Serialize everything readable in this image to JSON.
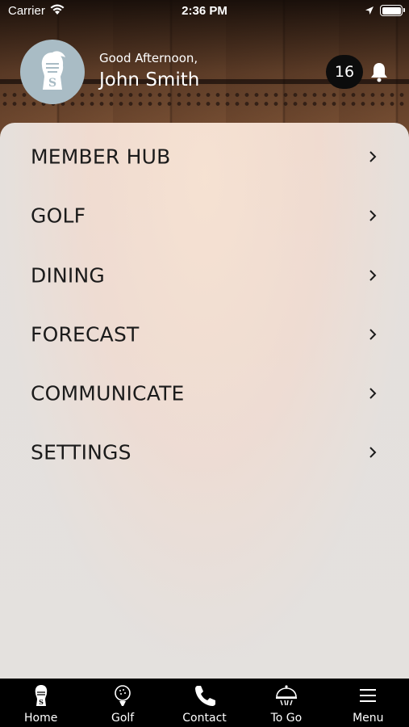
{
  "status_bar": {
    "carrier": "Carrier",
    "time": "2:36 PM"
  },
  "profile": {
    "greeting": "Good Afternoon,",
    "name": "John Smith",
    "notification_count": "16"
  },
  "menu": {
    "items": [
      {
        "label": "MEMBER HUB"
      },
      {
        "label": "GOLF"
      },
      {
        "label": "DINING"
      },
      {
        "label": "FORECAST"
      },
      {
        "label": "COMMUNICATE"
      },
      {
        "label": "SETTINGS"
      }
    ]
  },
  "tab_bar": {
    "tabs": [
      {
        "label": "Home",
        "icon": "knight-icon"
      },
      {
        "label": "Golf",
        "icon": "golf-ball-icon"
      },
      {
        "label": "Contact",
        "icon": "phone-icon"
      },
      {
        "label": "To Go",
        "icon": "cloche-icon"
      },
      {
        "label": "Menu",
        "icon": "hamburger-icon"
      }
    ]
  },
  "colors": {
    "avatar_bg": "#a9bcc5",
    "tab_bar_bg": "#000000",
    "menu_text": "#1b1b1b"
  }
}
